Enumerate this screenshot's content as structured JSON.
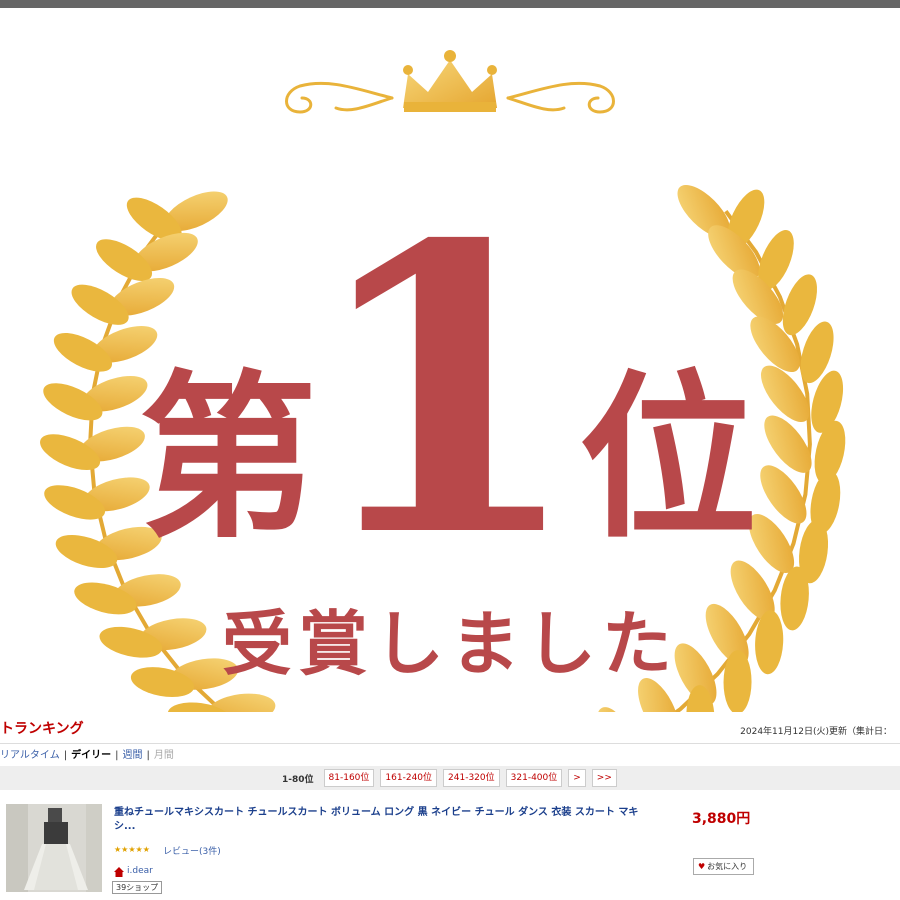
{
  "banner": {
    "rank_prefix": "第",
    "rank_number": "1",
    "rank_suffix": "位",
    "subtitle": "受賞しました",
    "colors": {
      "text": "#b8484a",
      "gold": "#e9b33a",
      "gold_light": "#f7d77a"
    },
    "decorations": [
      "laurel-wreath",
      "crown"
    ]
  },
  "ranking": {
    "title": "トランキング",
    "updated": "2024年11月12日(火)更新（集計日：",
    "periods": [
      {
        "label": "リアルタイム",
        "state": "link"
      },
      {
        "label": "デイリー",
        "state": "active"
      },
      {
        "label": "週間",
        "state": "link"
      },
      {
        "label": "月間",
        "state": "disabled"
      }
    ],
    "separator": "|",
    "pager": {
      "current": "1-80位",
      "pages": [
        "81-160位",
        "161-240位",
        "241-320位",
        "321-400位"
      ],
      "next": ">",
      "last": ">>"
    }
  },
  "item": {
    "title": "重ねチュールマキシスカート チュールスカート ボリューム ロング 黒 ネイビー チュール ダンス 衣装 スカート マキシ...",
    "price": "3,880円",
    "stars": "★★★★★",
    "rating": 5,
    "review_label": "レビュー(3件)",
    "shop_name": "i.dear",
    "shop_badge": "39ショップ",
    "favorite_label": "お気に入り"
  }
}
